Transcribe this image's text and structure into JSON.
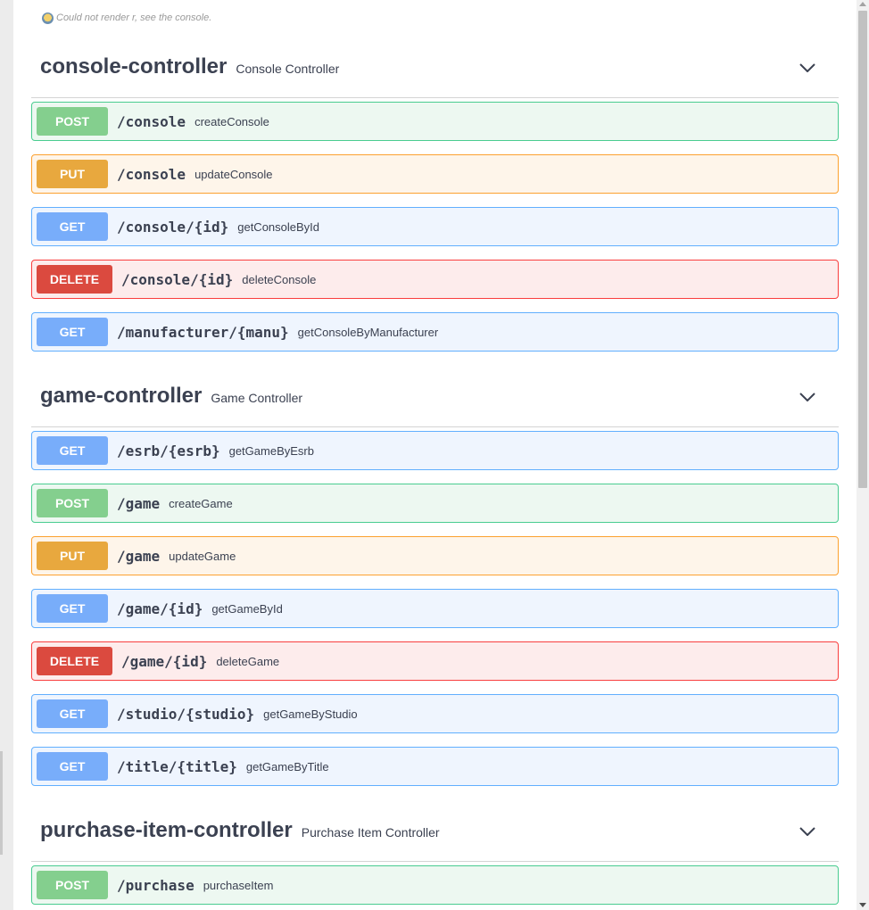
{
  "error_message": "Could not render r, see the console.",
  "sections": [
    {
      "name": "console-controller",
      "description": "Console Controller",
      "operations": [
        {
          "method": "POST",
          "path": "/console",
          "summary": "createConsole"
        },
        {
          "method": "PUT",
          "path": "/console",
          "summary": "updateConsole"
        },
        {
          "method": "GET",
          "path": "/console/{id}",
          "summary": "getConsoleById"
        },
        {
          "method": "DELETE",
          "path": "/console/{id}",
          "summary": "deleteConsole"
        },
        {
          "method": "GET",
          "path": "/manufacturer/{manu}",
          "summary": "getConsoleByManufacturer"
        }
      ]
    },
    {
      "name": "game-controller",
      "description": "Game Controller",
      "operations": [
        {
          "method": "GET",
          "path": "/esrb/{esrb}",
          "summary": "getGameByEsrb"
        },
        {
          "method": "POST",
          "path": "/game",
          "summary": "createGame"
        },
        {
          "method": "PUT",
          "path": "/game",
          "summary": "updateGame"
        },
        {
          "method": "GET",
          "path": "/game/{id}",
          "summary": "getGameById"
        },
        {
          "method": "DELETE",
          "path": "/game/{id}",
          "summary": "deleteGame"
        },
        {
          "method": "GET",
          "path": "/studio/{studio}",
          "summary": "getGameByStudio"
        },
        {
          "method": "GET",
          "path": "/title/{title}",
          "summary": "getGameByTitle"
        }
      ]
    },
    {
      "name": "purchase-item-controller",
      "description": "Purchase Item Controller",
      "operations": [
        {
          "method": "POST",
          "path": "/purchase",
          "summary": "purchaseItem"
        }
      ]
    }
  ],
  "colors": {
    "post": "#49cc90",
    "put": "#fca130",
    "get": "#61affe",
    "delete": "#f93e3e",
    "text": "#3b4151"
  },
  "icons": {
    "error": "screaming-face-icon",
    "section_toggle": "chevron-down-icon"
  }
}
